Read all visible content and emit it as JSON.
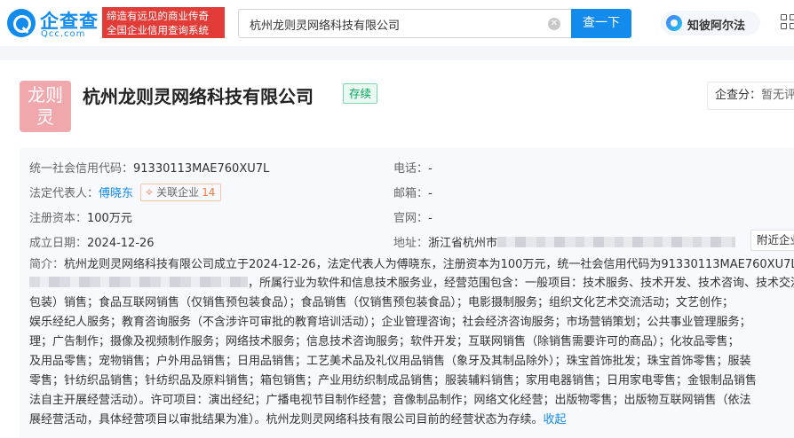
{
  "header": {
    "logo_cn": "企查查",
    "logo_en": "Qcc.com",
    "slogan_line1": "缔造有远见的商业传奇",
    "slogan_line2": "全国企业信用查询系统",
    "search_value": "杭州龙则灵网络科技有限公司",
    "search_button": "查一下",
    "zhibi_label": "知彼阿尔法"
  },
  "company": {
    "avatar_line1": "龙则",
    "avatar_line2": "灵",
    "name": "杭州龙则灵网络科技有限公司",
    "status": "存续",
    "review_label": "企查分：",
    "review_value": "暂无评分"
  },
  "info": {
    "credit_code_label": "统一社会信用代码：",
    "credit_code": "91330113MAE760XU7L",
    "legal_rep_label": "法定代表人：",
    "legal_rep": "傅晓东",
    "related_label": "关联企业",
    "related_count": "14",
    "capital_label": "注册资本：",
    "capital": "100万元",
    "founded_label": "成立日期：",
    "founded": "2024-12-26",
    "phone_label": "电话：",
    "phone": "-",
    "email_label": "邮箱：",
    "email": "-",
    "website_label": "官网：",
    "website": "-",
    "address_label": "地址：",
    "address_visible": "浙江省杭州市",
    "nearby_button": "附近企业"
  },
  "intro": {
    "label": "简介：",
    "line1": "杭州龙则灵网络科技有限公司成立于2024-12-26，法定代表人为傅晓东，注册资本为100万元，统一社会信用代码为91330113MAE760XU7L，",
    "line2": "，所属行业为软件和信息技术服务业，经营范围包含：一般项目：技术服务、技术开发、技术咨询、技术交流、",
    "line3": "包装）销售；食品互联网销售（仅销售预包装食品）；食品销售（仅销售预包装食品）；电影摄制服务；组织文化艺术交流活动；文艺创作；",
    "line4": "娱乐经纪人服务；教育咨询服务（不含涉许可审批的教育培训活动）；企业管理咨询；社会经济咨询服务；市场营销策划；公共事业管理服务；",
    "line5": "理；广告制作；摄像及视频制作服务；网络技术服务；信息技术咨询服务；软件开发；互联网销售（除销售需要许可的商品）；化妆品零售；",
    "line6": "及用品零售；宠物销售；户外用品销售；日用品销售；工艺美术品及礼仪用品销售（象牙及其制品除外）；珠宝首饰批发；珠宝首饰零售；服装",
    "line7": "零售；针纺织品销售；针纺织品及原料销售；箱包销售；产业用纺织制成品销售；服装辅料销售；家用电器销售；日用家电零售；金银制品销售",
    "line8": "法自主开展经营活动）。许可项目：演出经纪；广播电视节目制作经营；音像制品制作；网络文化经营；出版物零售；出版物互联网销售（依法",
    "line9": "展经营活动，具体经营项目以审批结果为准）。杭州龙则灵网络科技有限公司目前的经营状态为存续。",
    "collapse": "收起"
  }
}
